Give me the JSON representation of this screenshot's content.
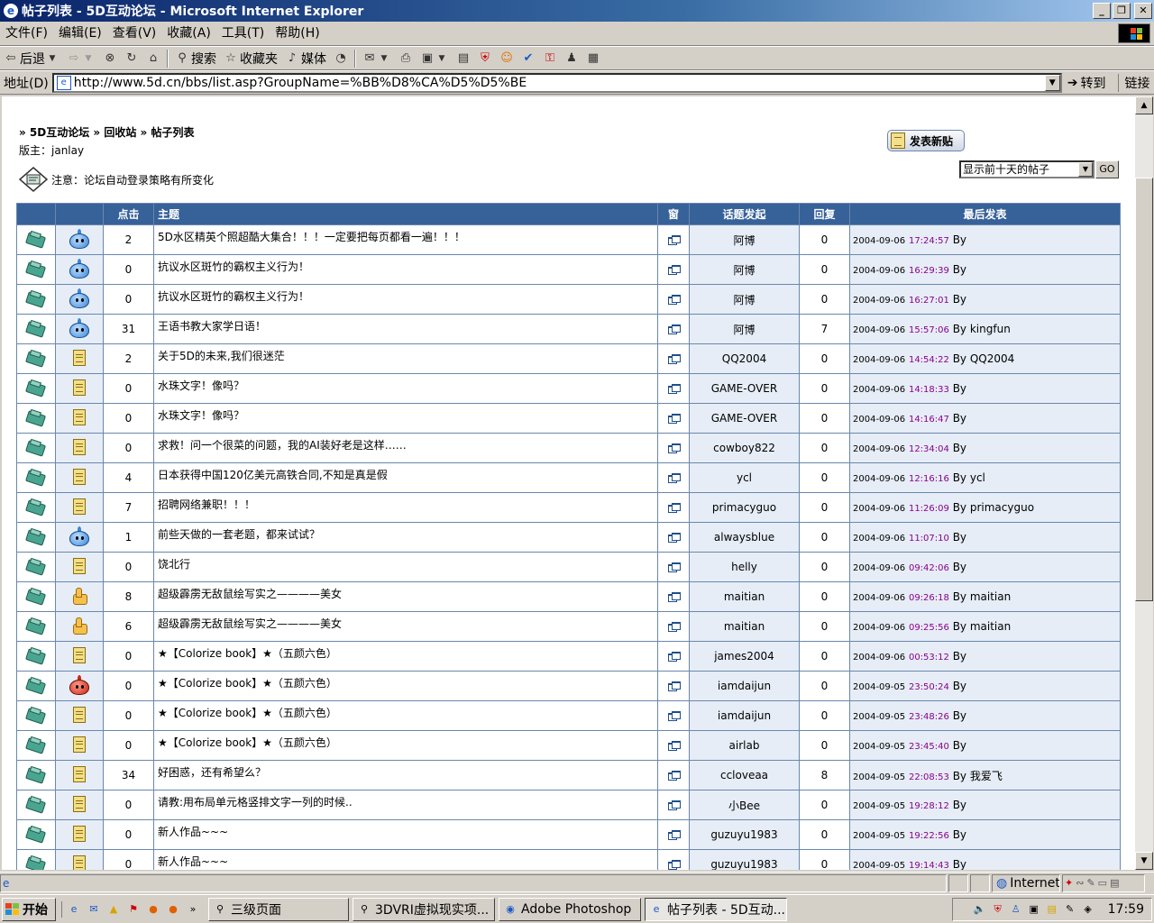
{
  "window": {
    "title": "帖子列表 - 5D互动论坛 - Microsoft Internet Explorer",
    "controls": [
      "_",
      "❐",
      "✕"
    ]
  },
  "menu": [
    "文件(F)",
    "编辑(E)",
    "查看(V)",
    "收藏(A)",
    "工具(T)",
    "帮助(H)"
  ],
  "toolbar": {
    "back": "后退",
    "search": "搜索",
    "favorites": "收藏夹",
    "media": "媒体"
  },
  "address": {
    "label": "地址(D)",
    "url": "http://www.5d.cn/bbs/list.asp?GroupName=%BB%D8%CA%D5%D5%BE",
    "go": "转到",
    "links": "链接"
  },
  "page": {
    "breadcrumb": "» 5D互动论坛 » 回收站 » 帖子列表",
    "moderator": "版主：janlay",
    "notice": "注意：论坛自动登录策略有所变化",
    "new_post": "发表新贴",
    "filter": "显示前十天的帖子",
    "go": "GO"
  },
  "table": {
    "headers": {
      "clicks": "点击",
      "subject": "主题",
      "window": "窗",
      "author": "话题发起",
      "replies": "回复",
      "last": "最后发表"
    },
    "rows": [
      {
        "icon": "slime",
        "clicks": "2",
        "subject": "5D水区精英个照超酷大集合！！！一定要把每页都看一遍！！！",
        "author": "阿博",
        "replies": "0",
        "date": "2004-09-06",
        "time": "17:24:57",
        "by": "By"
      },
      {
        "icon": "slime",
        "clicks": "0",
        "subject": "抗议水区斑竹的霸权主义行为！",
        "author": "阿博",
        "replies": "0",
        "date": "2004-09-06",
        "time": "16:29:39",
        "by": "By"
      },
      {
        "icon": "slime",
        "clicks": "0",
        "subject": "抗议水区斑竹的霸权主义行为！",
        "author": "阿博",
        "replies": "0",
        "date": "2004-09-06",
        "time": "16:27:01",
        "by": "By"
      },
      {
        "icon": "slime",
        "clicks": "31",
        "subject": "王语书教大家学日语！",
        "author": "阿博",
        "replies": "7",
        "date": "2004-09-06",
        "time": "15:57:06",
        "by": "By kingfun"
      },
      {
        "icon": "note",
        "clicks": "2",
        "subject": "关于5D的未来,我们很迷茫",
        "author": "QQ2004",
        "replies": "0",
        "date": "2004-09-06",
        "time": "14:54:22",
        "by": "By QQ2004"
      },
      {
        "icon": "note",
        "clicks": "0",
        "subject": "水珠文字！像吗？",
        "author": "GAME-OVER",
        "replies": "0",
        "date": "2004-09-06",
        "time": "14:18:33",
        "by": "By"
      },
      {
        "icon": "note",
        "clicks": "0",
        "subject": "水珠文字！像吗？",
        "author": "GAME-OVER",
        "replies": "0",
        "date": "2004-09-06",
        "time": "14:16:47",
        "by": "By"
      },
      {
        "icon": "note",
        "clicks": "0",
        "subject": "求救！问一个很菜的问题，我的AI装好老是这样……",
        "author": "cowboy822",
        "replies": "0",
        "date": "2004-09-06",
        "time": "12:34:04",
        "by": "By"
      },
      {
        "icon": "note",
        "clicks": "4",
        "subject": "日本获得中国120亿美元高铁合同,不知是真是假",
        "author": "ycl",
        "replies": "0",
        "date": "2004-09-06",
        "time": "12:16:16",
        "by": "By ycl"
      },
      {
        "icon": "note",
        "clicks": "7",
        "subject": "招聘网络兼职！！！",
        "author": "primacyguo",
        "replies": "0",
        "date": "2004-09-06",
        "time": "11:26:09",
        "by": "By primacyguo"
      },
      {
        "icon": "slime",
        "clicks": "1",
        "subject": "前些天做的一套老题，都来试试？",
        "author": "alwaysblue",
        "replies": "0",
        "date": "2004-09-06",
        "time": "11:07:10",
        "by": "By"
      },
      {
        "icon": "note",
        "clicks": "0",
        "subject": "饶北行",
        "author": "helly",
        "replies": "0",
        "date": "2004-09-06",
        "time": "09:42:06",
        "by": "By"
      },
      {
        "icon": "thumb",
        "clicks": "8",
        "subject": "超级霹雳无敌鼠绘写实之————美女",
        "author": "maitian",
        "replies": "0",
        "date": "2004-09-06",
        "time": "09:26:18",
        "by": "By maitian"
      },
      {
        "icon": "thumb",
        "clicks": "6",
        "subject": "超级霹雳无敌鼠绘写实之————美女",
        "author": "maitian",
        "replies": "0",
        "date": "2004-09-06",
        "time": "09:25:56",
        "by": "By maitian"
      },
      {
        "icon": "note",
        "clicks": "0",
        "subject": "★【Colorize book】★（五颜六色）",
        "author": "james2004",
        "replies": "0",
        "date": "2004-09-06",
        "time": "00:53:12",
        "by": "By"
      },
      {
        "icon": "slime-red",
        "clicks": "0",
        "subject": "★【Colorize book】★（五颜六色）",
        "author": "iamdaijun",
        "replies": "0",
        "date": "2004-09-05",
        "time": "23:50:24",
        "by": "By"
      },
      {
        "icon": "note",
        "clicks": "0",
        "subject": "★【Colorize book】★（五颜六色）",
        "author": "iamdaijun",
        "replies": "0",
        "date": "2004-09-05",
        "time": "23:48:26",
        "by": "By"
      },
      {
        "icon": "note",
        "clicks": "0",
        "subject": "★【Colorize book】★（五颜六色）",
        "author": "airlab",
        "replies": "0",
        "date": "2004-09-05",
        "time": "23:45:40",
        "by": "By"
      },
      {
        "icon": "note",
        "clicks": "34",
        "subject": "好困惑，还有希望么？",
        "author": "ccloveaa",
        "replies": "8",
        "date": "2004-09-05",
        "time": "22:08:53",
        "by": "By 我爱飞"
      },
      {
        "icon": "note",
        "clicks": "0",
        "subject": "请教:用布局单元格竖排文字一列的时候..",
        "author": "小Bee",
        "replies": "0",
        "date": "2004-09-05",
        "time": "19:28:12",
        "by": "By"
      },
      {
        "icon": "note",
        "clicks": "0",
        "subject": "新人作品~~~",
        "author": "guzuyu1983",
        "replies": "0",
        "date": "2004-09-05",
        "time": "19:22:56",
        "by": "By"
      },
      {
        "icon": "note",
        "clicks": "0",
        "subject": "新人作品~~~",
        "author": "guzuyu1983",
        "replies": "0",
        "date": "2004-09-05",
        "time": "19:14:43",
        "by": "By"
      }
    ]
  },
  "status": {
    "zone": "Internet"
  },
  "taskbar": {
    "start": "开始",
    "tasks": [
      "三级页面",
      "3DVRI虚拟现实项...",
      "Adobe Photoshop",
      "帖子列表 - 5D互动..."
    ],
    "clock": "17:59"
  }
}
